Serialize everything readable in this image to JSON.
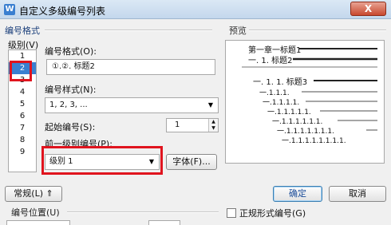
{
  "window": {
    "title": "自定义多级编号列表",
    "close_label": "X",
    "app_icon": "W"
  },
  "number_format_section": {
    "label": "编号格式"
  },
  "level": {
    "label": "级别(V)",
    "items": [
      "1",
      "2",
      "3",
      "4",
      "5",
      "6",
      "7",
      "8",
      "9"
    ],
    "selected_index": 1
  },
  "format_field": {
    "label": "编号格式(O):",
    "value": "①.②. 标题2"
  },
  "style_field": {
    "label": "编号样式(N):",
    "value": "1, 2, 3, ..."
  },
  "start_number": {
    "label": "起始编号(S):",
    "value": "1"
  },
  "prev_level": {
    "label": "前一级别编号(P):",
    "value": "级别 1"
  },
  "font_button": {
    "label": "字体(F)..."
  },
  "preview": {
    "label": "预览",
    "lines": [
      "第一章一标题1",
      "一. 1. 标题2",
      "一. 1. 1. 标题3",
      "一.1.1.1.",
      "一.1.1.1.1.",
      "一.1.1.1.1.1.",
      "一.1.1.1.1.1.1.",
      "一.1.1.1.1.1.1.1.",
      "一.1.1.1.1.1.1.1.1."
    ]
  },
  "normal_button": {
    "label": "常规(L) ⇑"
  },
  "ok_button": {
    "label": "确定"
  },
  "cancel_button": {
    "label": "取消"
  },
  "position_label": {
    "label": "编号位置(U)"
  },
  "legal_checkbox": {
    "label": "正规形式编号(G)",
    "checked": false
  },
  "highlight_color": "#e0141e",
  "accent_color": "#3a7fd0"
}
